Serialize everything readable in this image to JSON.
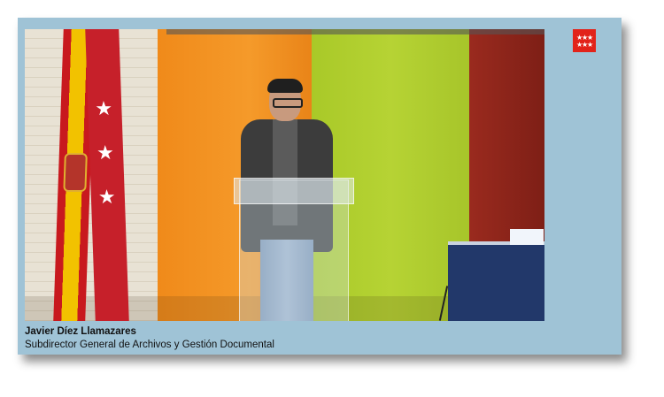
{
  "caption": {
    "name": "Javier Díez Llamazares",
    "role": "Subdirector General de Archivos y Gestión Documental"
  },
  "logo": {
    "icon": "comunidad-de-madrid-logo-icon",
    "color": "#e2231a",
    "star_glyph": "★"
  },
  "colors": {
    "frame": "#9fc3d6",
    "wall_orange": "#f08a1a",
    "wall_green": "#a9c928",
    "wall_red": "#9a2a1e"
  }
}
